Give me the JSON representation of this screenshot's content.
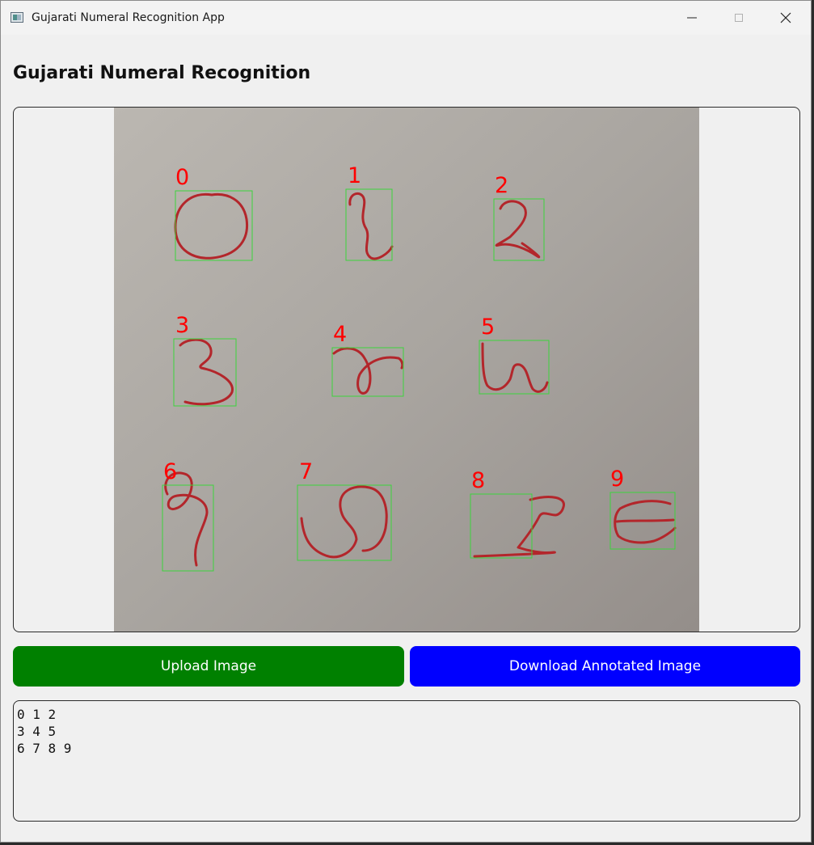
{
  "window": {
    "title": "Gujarati Numeral Recognition App",
    "controls": [
      "minimize",
      "maximize",
      "close"
    ]
  },
  "header": {
    "title": "Gujarati Numeral Recognition"
  },
  "image_view": {
    "detections": [
      {
        "label": "0",
        "glyph": "zero-circle"
      },
      {
        "label": "1",
        "glyph": "one"
      },
      {
        "label": "2",
        "glyph": "two"
      },
      {
        "label": "3",
        "glyph": "three"
      },
      {
        "label": "4",
        "glyph": "four"
      },
      {
        "label": "5",
        "glyph": "five"
      },
      {
        "label": "6",
        "glyph": "six"
      },
      {
        "label": "7",
        "glyph": "seven"
      },
      {
        "label": "8",
        "glyph": "eight"
      },
      {
        "label": "9",
        "glyph": "nine"
      }
    ],
    "box_color": "#3cd43c",
    "label_color": "#ff0000",
    "ink_color": "#b3262b"
  },
  "actions": {
    "upload_label": "Upload Image",
    "upload_color": "#008000",
    "download_label": "Download Annotated Image",
    "download_color": "#0000ff"
  },
  "result": {
    "lines": [
      "0 1 2",
      "3 4 5",
      "6 7 8 9"
    ]
  }
}
